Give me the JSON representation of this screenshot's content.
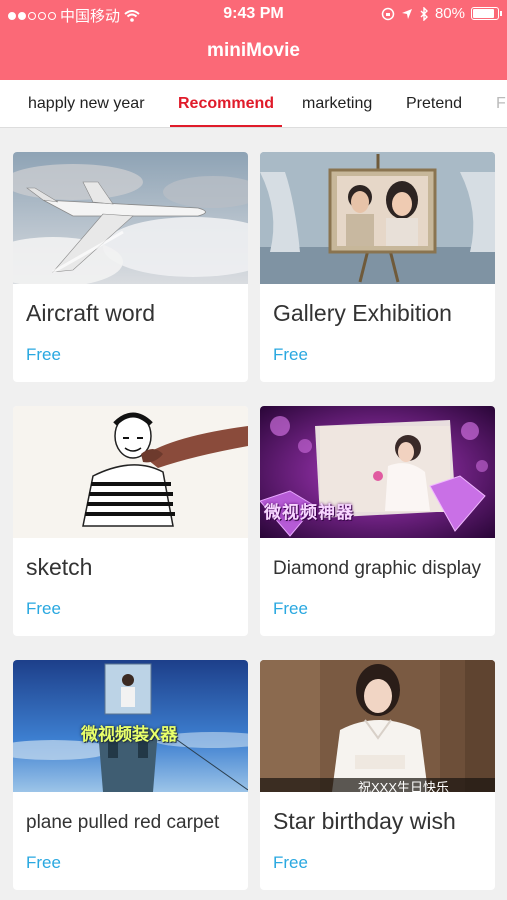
{
  "status": {
    "carrier": "中国移动",
    "time": "9:43 PM",
    "battery": "80%",
    "battery_level": 0.8
  },
  "app": {
    "title": "miniMovie"
  },
  "tabs": [
    {
      "label": "happly new year"
    },
    {
      "label": "Recommend"
    },
    {
      "label": "marketing"
    },
    {
      "label": "Pretend"
    },
    {
      "label": "F"
    }
  ],
  "cards": [
    {
      "title": "Aircraft word",
      "price": "Free"
    },
    {
      "title": "Gallery Exhibition",
      "price": "Free"
    },
    {
      "title": "sketch",
      "price": "Free"
    },
    {
      "title": "Diamond graphic display",
      "price": "Free",
      "overlay": "微视频神器"
    },
    {
      "title": "plane pulled red carpet",
      "price": "Free",
      "overlay": "微视频装X器"
    },
    {
      "title": "Star birthday wish",
      "price": "Free",
      "overlay": "祝XXX生日快乐"
    }
  ]
}
